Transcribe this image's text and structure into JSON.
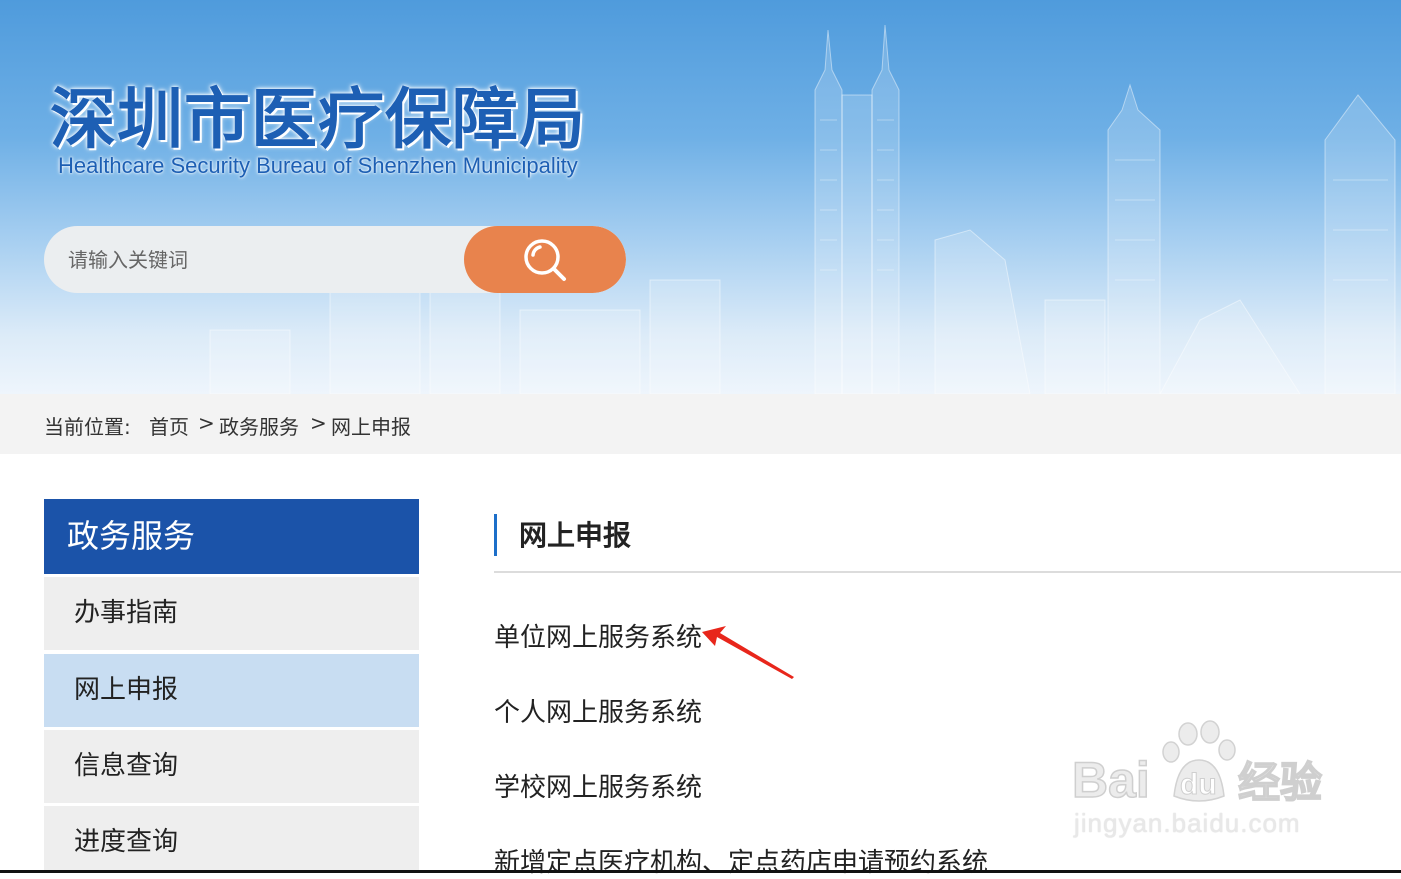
{
  "header": {
    "logo_cn": "深圳市医疗保障局",
    "logo_en": "Healthcare Security Bureau of Shenzhen Municipality"
  },
  "search": {
    "placeholder": "请输入关键词",
    "button_icon": "search-icon"
  },
  "breadcrumb": {
    "label": "当前位置:",
    "items": [
      "首页",
      "政务服务",
      "网上申报"
    ],
    "separator": ">"
  },
  "sidebar": {
    "title": "政务服务",
    "items": [
      {
        "label": "办事指南",
        "active": false
      },
      {
        "label": "网上申报",
        "active": true
      },
      {
        "label": "信息查询",
        "active": false
      },
      {
        "label": "进度查询",
        "active": false
      }
    ]
  },
  "main": {
    "section_title": "网上申报",
    "links": [
      "单位网上服务系统",
      "个人网上服务系统",
      "学校网上服务系统",
      "新增定点医疗机构、定点药店申请预约系统"
    ]
  },
  "annotation": {
    "icon": "red-arrow-icon",
    "color": "#e8261b"
  },
  "watermark": {
    "brand": "Bai du 经验",
    "url": "jingyan.baidu.com"
  },
  "colors": {
    "sidebar_title_bg": "#1b53a9",
    "sidebar_active_bg": "#c8ddf2",
    "search_button": "#e8834d",
    "logo_text": "#1d5fb4"
  }
}
